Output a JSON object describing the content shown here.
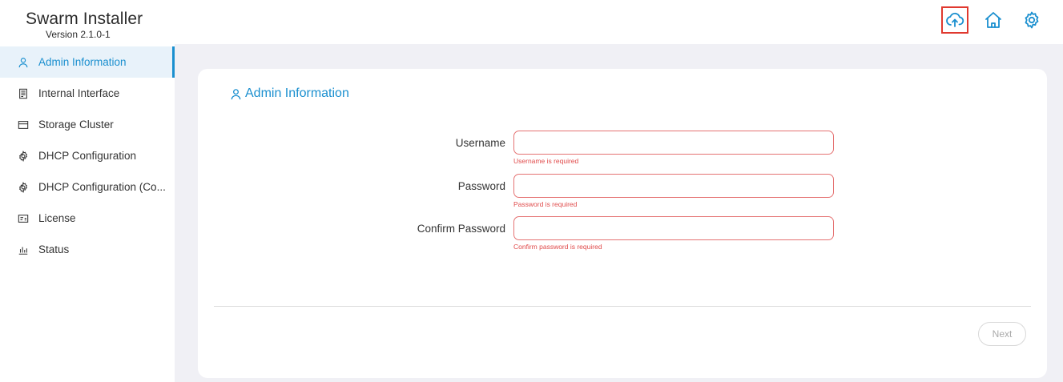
{
  "app": {
    "title": "Swarm Installer",
    "version": "Version 2.1.0-1"
  },
  "header_icons": [
    {
      "name": "cloud-upload-icon",
      "highlighted": true
    },
    {
      "name": "home-icon",
      "highlighted": false
    },
    {
      "name": "gear-icon",
      "highlighted": false
    }
  ],
  "sidebar": {
    "items": [
      {
        "label": "Admin Information",
        "icon": "user-icon",
        "active": true
      },
      {
        "label": "Internal Interface",
        "icon": "server-icon",
        "active": false
      },
      {
        "label": "Storage Cluster",
        "icon": "storage-icon",
        "active": false
      },
      {
        "label": "DHCP Configuration",
        "icon": "gear-icon",
        "active": false
      },
      {
        "label": "DHCP Configuration (Co...",
        "icon": "gear-icon",
        "active": false
      },
      {
        "label": "License",
        "icon": "license-icon",
        "active": false
      },
      {
        "label": "Status",
        "icon": "bar-chart-icon",
        "active": false
      }
    ]
  },
  "main": {
    "section_title": "Admin Information",
    "fields": {
      "username": {
        "label": "Username",
        "value": "",
        "error": "Username is required"
      },
      "password": {
        "label": "Password",
        "value": "",
        "error": "Password is required"
      },
      "confirm_password": {
        "label": "Confirm Password",
        "value": "",
        "error": "Confirm password is required"
      }
    },
    "next_label": "Next"
  },
  "colors": {
    "accent": "#1a8fcf",
    "error": "#e04b4b",
    "highlight_border": "#e0392f",
    "main_bg": "#f0f0f5"
  }
}
